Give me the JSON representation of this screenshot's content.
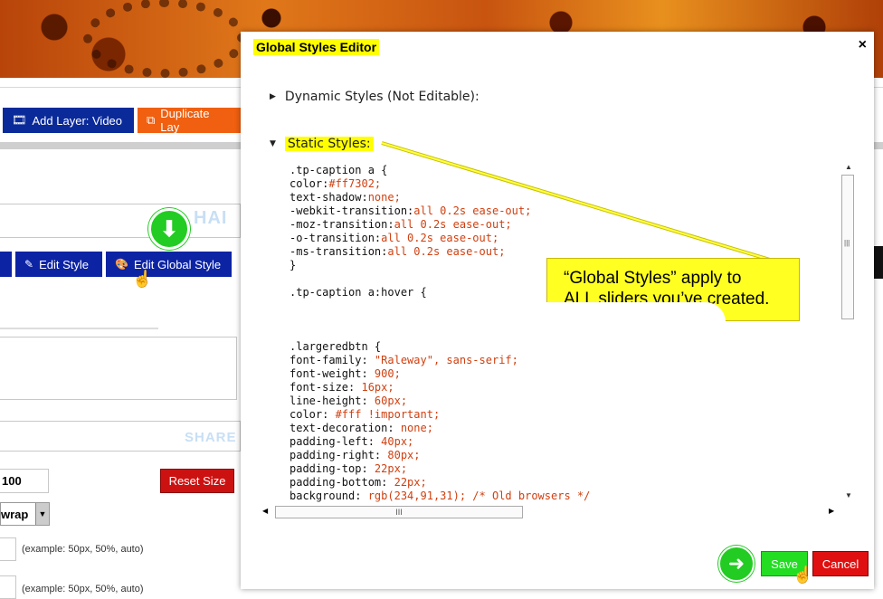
{
  "background": {
    "buttons": {
      "add_layer_video": "Add Layer: Video",
      "duplicate_layer": "Duplicate Lay",
      "edit_style": "Edit Style",
      "edit_global_style": "Edit Global Style",
      "reset_size": "Reset Size"
    },
    "faint_texts": {
      "top": "HAI",
      "share": "SHARE"
    },
    "size_value": "100",
    "wrap_select": "wrap",
    "example_text_1": "(example: 50px, 50%, auto)",
    "example_text_2": "(example: 50px, 50%, auto)"
  },
  "modal": {
    "title": "Global Styles Editor",
    "close": "×",
    "dynamic_section": "Dynamic Styles (Not Editable):",
    "static_section": "Static Styles:",
    "hscroll_grip": "III",
    "vscroll_grip": "|||",
    "callout_line1": "“Global Styles” apply to",
    "callout_line2": "ALL sliders you’ve created.",
    "save": "Save",
    "cancel": "Cancel",
    "code_lines_a": [
      ".tp-caption a {",
      "color:#ff7302;",
      "text-shadow:none;",
      "-webkit-transition:all 0.2s ease-out;",
      "-moz-transition:all 0.2s ease-out;",
      "-o-transition:all 0.2s ease-out;",
      "-ms-transition:all 0.2s ease-out;",
      "}",
      "",
      ".tp-caption a:hover {"
    ],
    "code_lines_b": [
      ".largeredbtn {",
      "font-family: \"Raleway\", sans-serif;",
      "font-weight: 900;",
      "font-size: 16px;",
      "line-height: 60px;",
      "color: #fff !important;",
      "text-decoration: none;",
      "padding-left: 40px;",
      "padding-right: 80px;",
      "padding-top: 22px;",
      "padding-bottom: 22px;",
      "background: rgb(234,91,31); /* Old browsers */"
    ]
  },
  "colors": {
    "highlight_yellow": "#ffff00",
    "button_blue": "#0c24a4",
    "save_green": "#22dd22",
    "cancel_red": "#e01010"
  }
}
